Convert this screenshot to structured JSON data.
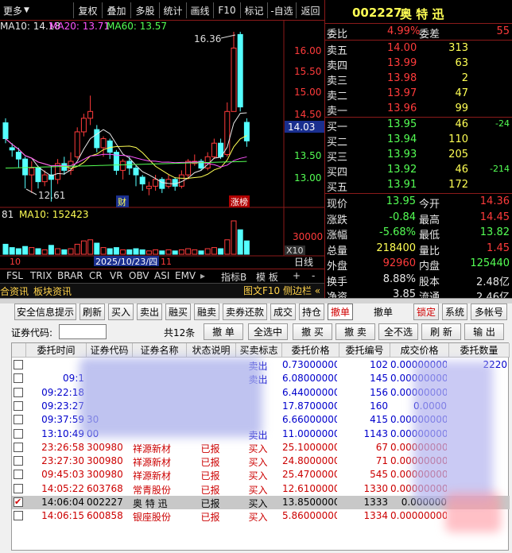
{
  "toolbar": {
    "items": [
      "更多",
      "复权",
      "叠加",
      "多股",
      "统计",
      "画线",
      "F10",
      "标记",
      "-自选",
      "返回"
    ]
  },
  "chart": {
    "ma_legend": {
      "ma10": "MA10: 14.18",
      "ma20": "MA20: 13.71",
      "ma60": "MA60: 13.57"
    },
    "price_axis": [
      "16.00",
      "15.50",
      "15.00",
      "14.50",
      "14.03",
      "13.50",
      "13.00"
    ],
    "high_label": "16.36",
    "low_label": "12.61",
    "markers": {
      "cai": "财",
      "zhangbang": "涨榜"
    },
    "volume_legend": {
      "vol": "81",
      "ma10": "MA10: 152423"
    },
    "volume_axis": "30000",
    "volume_unit": "X10",
    "date_tick": "10",
    "date_label": "2025/10/23/四",
    "date_tick2": "11",
    "right_label": "日线",
    "indicator_tabs": [
      "FSL",
      "TRIX",
      "BRAR",
      "CR",
      "VR",
      "OBV",
      "ASI",
      "EMV"
    ],
    "indicator_tools": [
      "指标B",
      "模 板",
      "+",
      "-"
    ],
    "info_tabs": [
      "合资讯",
      "板块资讯"
    ],
    "info_right": "图文F10 侧边栏 «"
  },
  "quote": {
    "code": "002227",
    "name": "奥 特 迅",
    "weibi_label": "委比",
    "weibi_value": "4.99%",
    "weicha_label": "委差",
    "weicha_value": "55",
    "asks": [
      {
        "label": "卖五",
        "price": "14.00",
        "vol": "313"
      },
      {
        "label": "卖四",
        "price": "13.99",
        "vol": "63"
      },
      {
        "label": "卖三",
        "price": "13.98",
        "vol": "2"
      },
      {
        "label": "卖二",
        "price": "13.97",
        "vol": "47"
      },
      {
        "label": "卖一",
        "price": "13.96",
        "vol": "99"
      }
    ],
    "bids": [
      {
        "label": "买一",
        "price": "13.95",
        "vol": "46",
        "change": "-24"
      },
      {
        "label": "买二",
        "price": "13.94",
        "vol": "110",
        "change": ""
      },
      {
        "label": "买三",
        "price": "13.93",
        "vol": "205",
        "change": ""
      },
      {
        "label": "买四",
        "price": "13.92",
        "vol": "46",
        "change": "-214"
      },
      {
        "label": "买五",
        "price": "13.91",
        "vol": "172",
        "change": ""
      }
    ],
    "stats": [
      {
        "l1": "现价",
        "v1": "13.95",
        "l2": "今开",
        "v2": "14.36"
      },
      {
        "l1": "涨跌",
        "v1": "-0.84",
        "l2": "最高",
        "v2": "14.45"
      },
      {
        "l1": "涨幅",
        "v1": "-5.68%",
        "l2": "最低",
        "v2": "13.82"
      },
      {
        "l1": "总量",
        "v1": "218400",
        "l2": "量比",
        "v2": "1.45"
      },
      {
        "l1": "外盘",
        "v1": "92960",
        "l2": "内盘",
        "v2": "125440"
      },
      {
        "l1": "换手",
        "v1": "8.88%",
        "l2": "股本",
        "v2": "2.48亿"
      },
      {
        "l1": "净资",
        "v1": "3.85",
        "l2": "流通",
        "v2": "2.46亿"
      }
    ]
  },
  "trade": {
    "buttons": [
      "安全信息提示",
      "刷新",
      "买入",
      "卖出",
      "融买",
      "融卖",
      "卖券还款",
      "成交",
      "持仓",
      "撤单",
      "撤单",
      "锁定",
      "系统",
      "多帐号"
    ],
    "filter": {
      "code_label": "证券代码:",
      "code_value": "",
      "count_label": "共12条",
      "actions": [
        "撤 单",
        "全选中",
        "撤 买",
        "撤 卖",
        "全不选",
        "刷 新",
        "输 出"
      ]
    },
    "columns": [
      "委托时间",
      "证券代码",
      "证券名称",
      "状态说明",
      "买卖标志",
      "委托价格",
      "委托编号",
      "成交价格",
      "委托数量"
    ],
    "rows": [
      {
        "time": "",
        "code": "",
        "name": "",
        "status": "",
        "side": "卖出",
        "price": "0.73000000",
        "no": "102",
        "deal": "0.00000000",
        "qty": "2220",
        "color": "#0000cc",
        "checked": false
      },
      {
        "time": "09:1",
        "code": "",
        "name": "",
        "status": "",
        "side": "卖出",
        "price": "6.08000000",
        "no": "145",
        "deal": "0.00000000",
        "qty": "",
        "color": "#0000cc",
        "checked": false
      },
      {
        "time": "09:22:18",
        "code": "",
        "name": "",
        "status": "",
        "side": "",
        "price": "6.44000000",
        "no": "156",
        "deal": "0.00000000",
        "qty": "",
        "color": "#0000cc",
        "checked": false
      },
      {
        "time": "09:23:27",
        "code": "",
        "name": "",
        "status": "",
        "side": "",
        "price": "17.87000000",
        "no": "160",
        "deal": "0.0000",
        "qty": "",
        "color": "#0000cc",
        "checked": false
      },
      {
        "time": "09:37:59",
        "code": "30",
        "name": "",
        "status": "",
        "side": "",
        "price": "6.66000000",
        "no": "415",
        "deal": "0.00000000",
        "qty": "",
        "color": "#0000cc",
        "checked": false
      },
      {
        "time": "13:10:49",
        "code": "00",
        "name": "",
        "status": "",
        "side": "卖出",
        "price": "11.00000000",
        "no": "1143",
        "deal": "0.00000000",
        "qty": "",
        "color": "#0000cc",
        "checked": false
      },
      {
        "time": "23:26:58",
        "code": "300980",
        "name": "祥源新材",
        "status": "已报",
        "side": "买入",
        "price": "25.10000000",
        "no": "67",
        "deal": "0.00000000",
        "qty": "",
        "color": "#cc0000",
        "checked": false
      },
      {
        "time": "23:27:30",
        "code": "300980",
        "name": "祥源新材",
        "status": "已报",
        "side": "买入",
        "price": "24.80000000",
        "no": "71",
        "deal": "0.00000000",
        "qty": "",
        "color": "#cc0000",
        "checked": false
      },
      {
        "time": "09:45:03",
        "code": "300980",
        "name": "祥源新材",
        "status": "已报",
        "side": "买入",
        "price": "25.47000000",
        "no": "545",
        "deal": "0.00000000",
        "qty": "",
        "color": "#cc0000",
        "checked": false
      },
      {
        "time": "14:05:22",
        "code": "603768",
        "name": "常青股份",
        "status": "已报",
        "side": "买入",
        "price": "12.61000000",
        "no": "1330",
        "deal": "0.00000000",
        "qty": "",
        "color": "#cc0000",
        "checked": false
      },
      {
        "time": "14:06:04",
        "code": "002227",
        "name": "奥 特 迅",
        "status": "已报",
        "side": "买入",
        "price": "13.85000000",
        "no": "1333",
        "deal": "0.000000",
        "qty": "",
        "color": "#000000",
        "checked": true
      },
      {
        "time": "14:06:15",
        "code": "600858",
        "name": "银座股份",
        "status": "已报",
        "side": "买入",
        "price": "5.86000000",
        "no": "1334",
        "deal": "0.00000000",
        "qty": "",
        "color": "#cc0000",
        "checked": false
      }
    ]
  },
  "colors": {
    "up": "#ff3b3b",
    "down": "#54ffff",
    "yellow": "#ffff54",
    "magenta": "#ff54ff",
    "green": "#54ff54",
    "blue_text": "#0000cc"
  }
}
